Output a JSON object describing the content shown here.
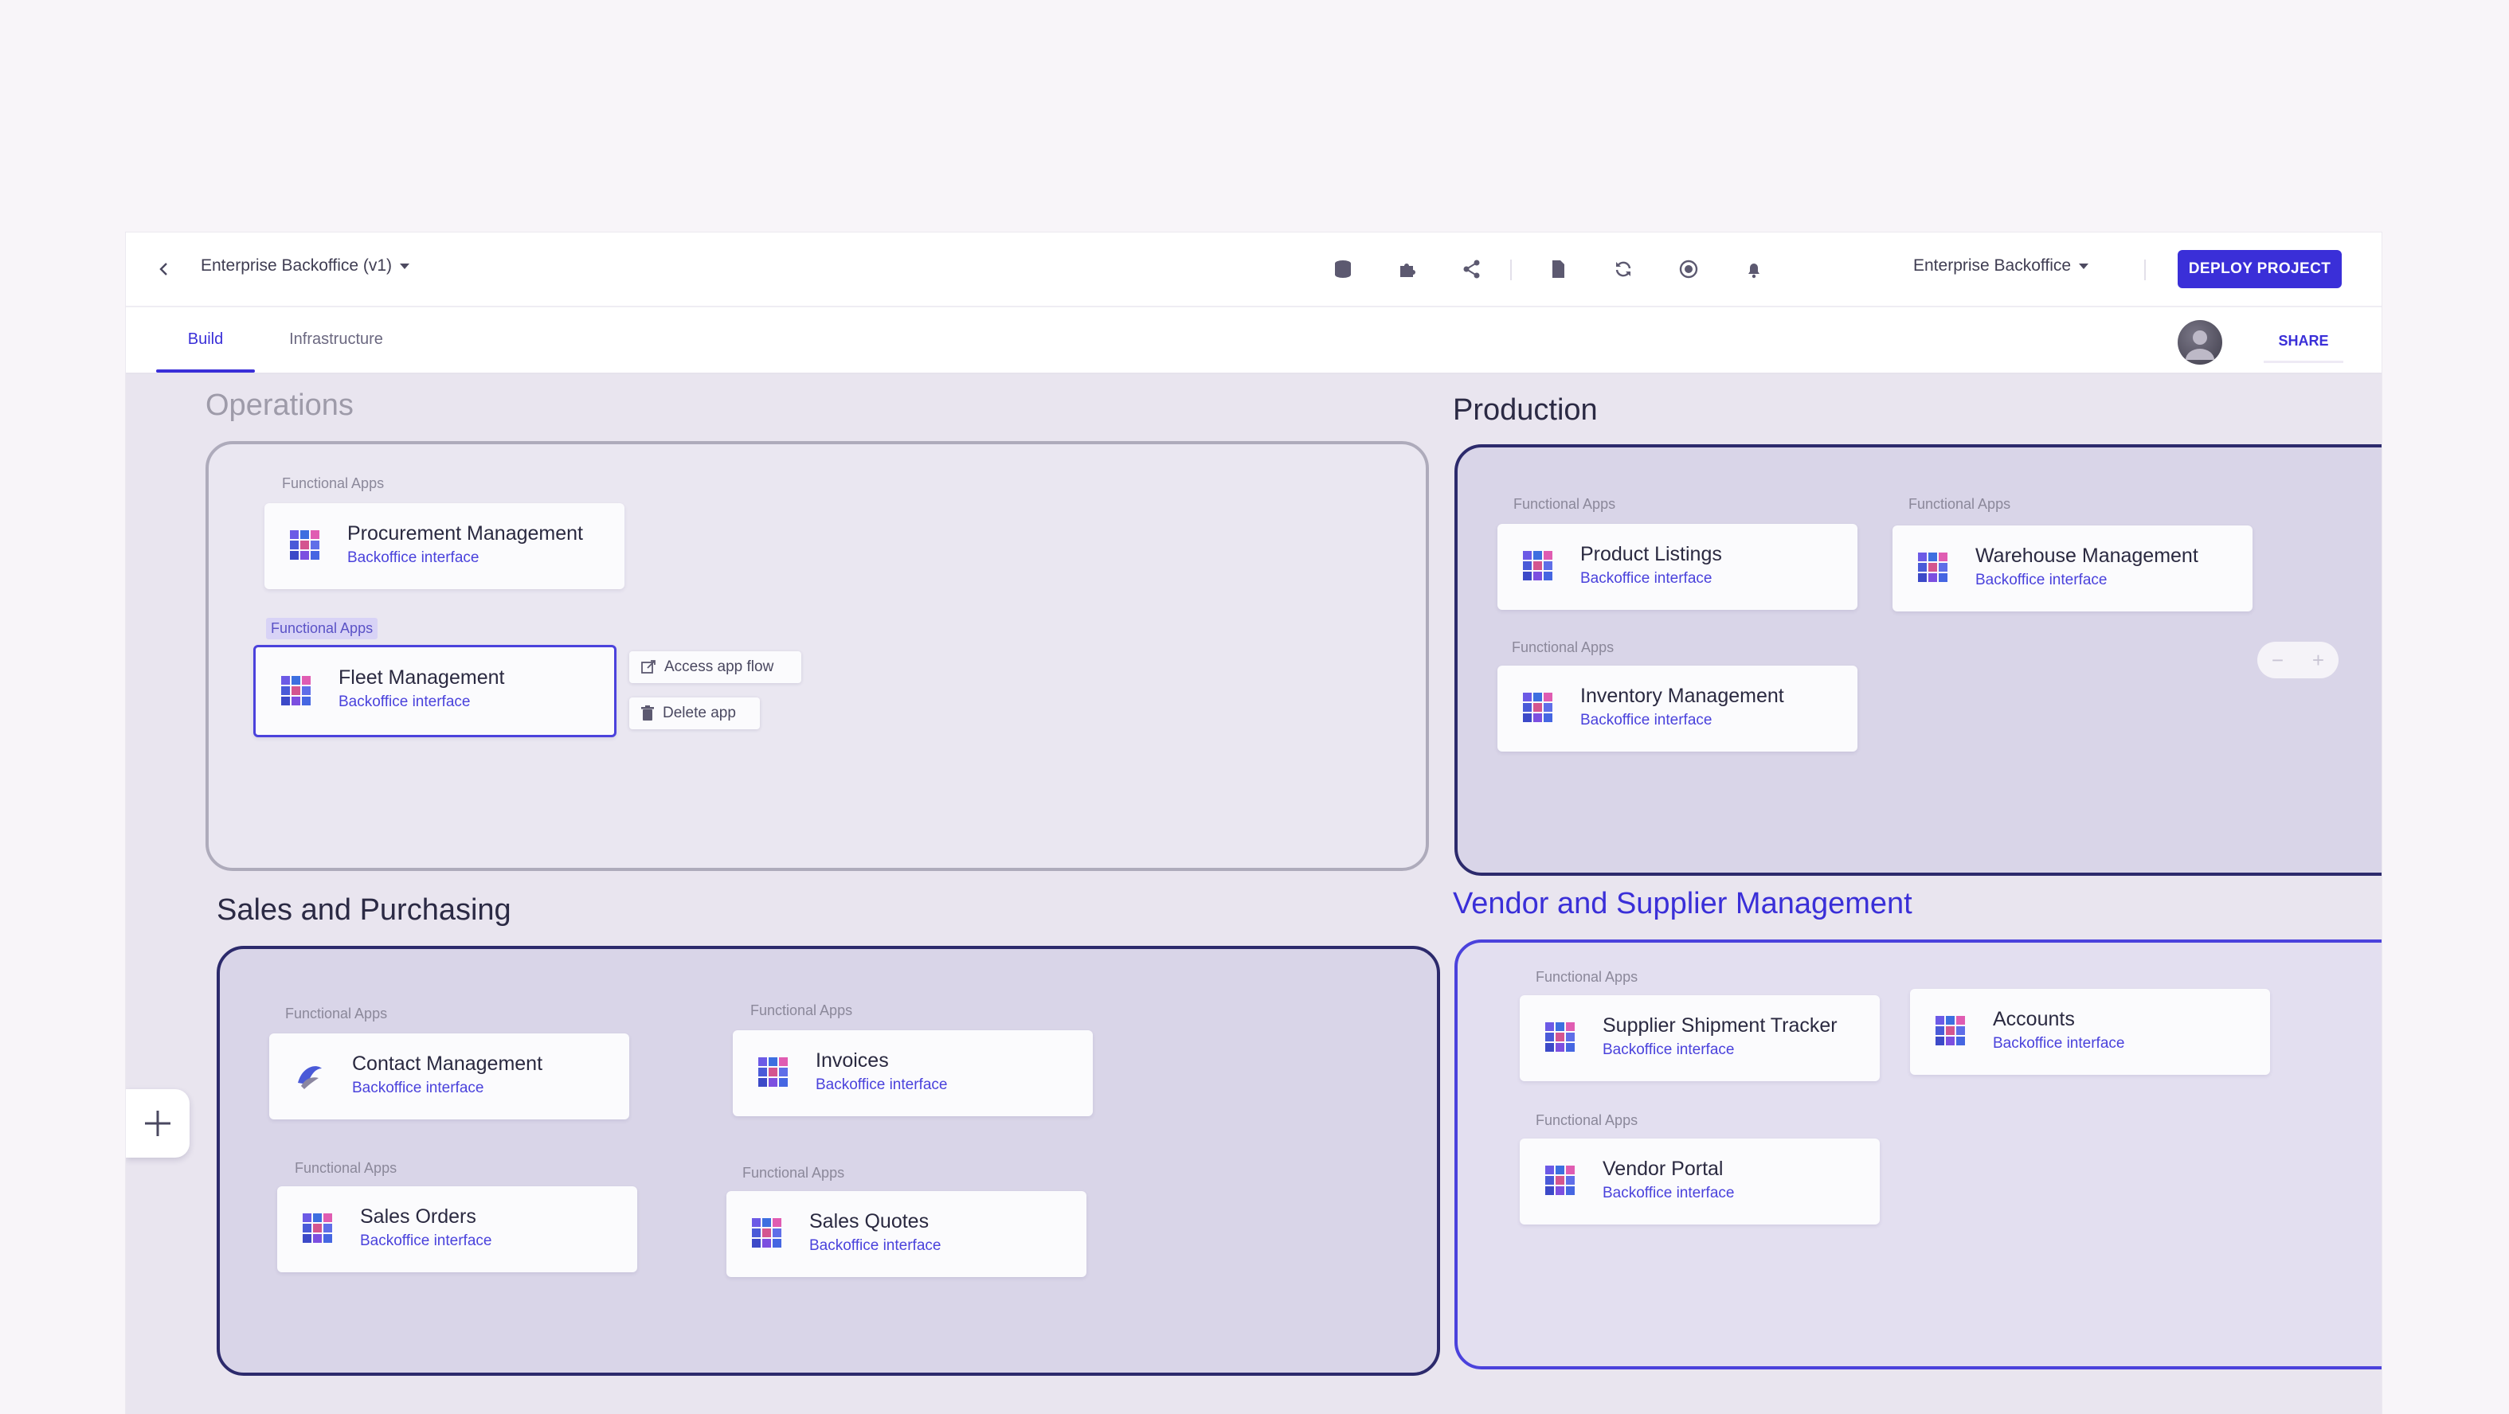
{
  "header": {
    "project_title": "Enterprise Backoffice (v1)",
    "environment": "Enterprise Backoffice",
    "deploy_label": "DEPLOY PROJECT",
    "tools": [
      "database-icon",
      "extension-icon",
      "share-nodes-icon",
      "document-icon",
      "sync-icon",
      "record-icon",
      "bell-icon"
    ]
  },
  "tabs": {
    "build": "Build",
    "infrastructure": "Infrastructure",
    "active": "build"
  },
  "share_label": "SHARE",
  "zoom": {
    "minus": "−",
    "plus": "+"
  },
  "context_menu": {
    "access": "Access app flow",
    "delete": "Delete app"
  },
  "groups": {
    "operations": {
      "title": "Operations",
      "apps": [
        {
          "label": "Functional Apps",
          "name": "Procurement Management",
          "subtitle": "Backoffice interface"
        },
        {
          "label": "Functional Apps",
          "name": "Fleet Management",
          "subtitle": "Backoffice interface"
        }
      ]
    },
    "production": {
      "title": "Production",
      "apps": [
        {
          "label": "Functional Apps",
          "name": "Product Listings",
          "subtitle": "Backoffice interface"
        },
        {
          "label": "Functional Apps",
          "name": "Warehouse Management",
          "subtitle": "Backoffice interface"
        },
        {
          "label": "Functional Apps",
          "name": "Inventory Management",
          "subtitle": "Backoffice interface"
        }
      ]
    },
    "sales": {
      "title": "Sales and Purchasing",
      "apps": [
        {
          "label": "Functional Apps",
          "name": "Contact Management",
          "subtitle": "Backoffice interface"
        },
        {
          "label": "Functional Apps",
          "name": "Invoices",
          "subtitle": "Backoffice interface"
        },
        {
          "label": "Functional Apps",
          "name": "Sales Orders",
          "subtitle": "Backoffice interface"
        },
        {
          "label": "Functional Apps",
          "name": "Sales Quotes",
          "subtitle": "Backoffice interface"
        }
      ]
    },
    "vendor": {
      "title": "Vendor and Supplier Management",
      "apps": [
        {
          "label": "Functional Apps",
          "name": "Supplier Shipment Tracker",
          "subtitle": "Backoffice interface"
        },
        {
          "name": "Accounts",
          "subtitle": "Backoffice interface"
        },
        {
          "label": "Functional Apps",
          "name": "Vendor Portal",
          "subtitle": "Backoffice interface"
        }
      ]
    }
  },
  "colors": {
    "accent": "#3a2fd8",
    "group_dark_border": "#2c2a6c",
    "group_blue_border": "#4b42dc"
  }
}
